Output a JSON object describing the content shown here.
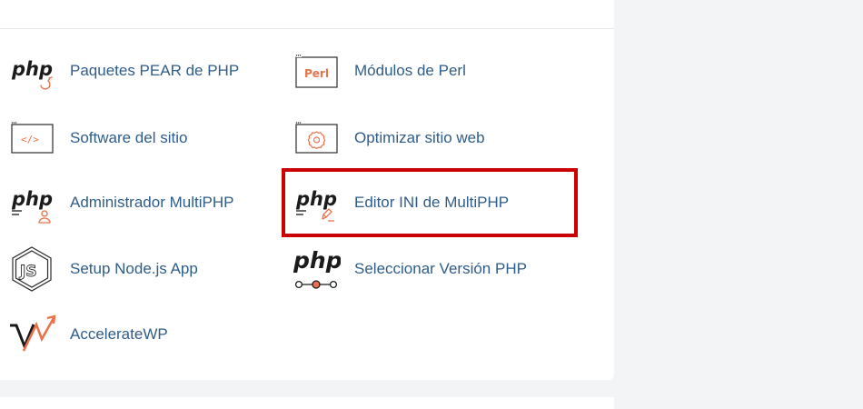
{
  "tools": {
    "pear": {
      "label": "Paquetes PEAR de PHP",
      "icon_text": "php"
    },
    "perl": {
      "label": "Módulos de Perl",
      "icon_text": "Perl"
    },
    "site_software": {
      "label": "Software del sitio",
      "icon_text": "</>"
    },
    "optimize": {
      "label": "Optimizar sitio web"
    },
    "multiphp_manager": {
      "label": "Administrador MultiPHP",
      "icon_text": "php"
    },
    "multiphp_ini": {
      "label": "Editor INI de MultiPHP",
      "icon_text": "php"
    },
    "nodejs": {
      "label": "Setup Node.js App",
      "icon_text": "JS"
    },
    "php_version": {
      "label": "Seleccionar Versión PHP",
      "icon_text": "php"
    },
    "acceleratewp": {
      "label": "AccelerateWP"
    }
  },
  "colors": {
    "link": "#2f5d8a",
    "accent": "#e8734a",
    "highlight": "#cc0000",
    "icon_dark": "#1b1b1b"
  }
}
